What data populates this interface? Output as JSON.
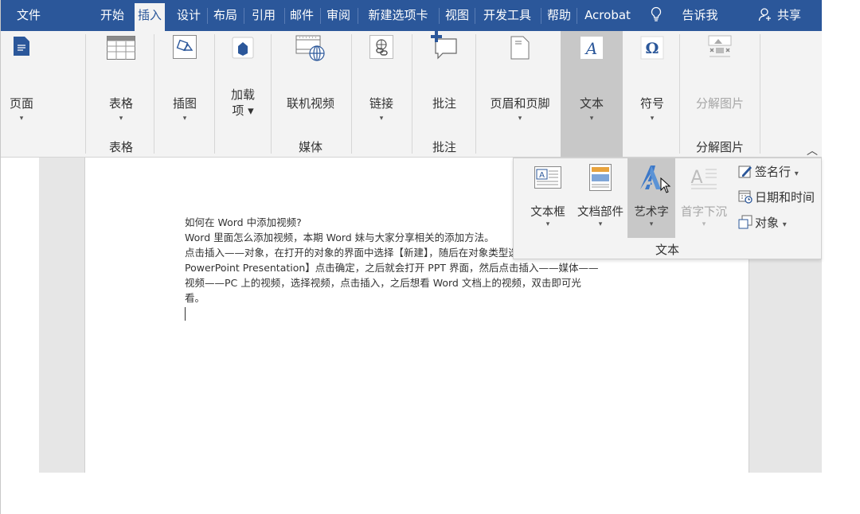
{
  "tabs": [
    "文件",
    "开始",
    "插入",
    "设计",
    "布局",
    "引用",
    "邮件",
    "审阅",
    "新建选项卡",
    "视图",
    "开发工具",
    "帮助",
    "Acrobat"
  ],
  "active_tab": "插入",
  "tell_me": "告诉我",
  "share": "共享",
  "ribbon": {
    "page": "页面",
    "table": "表格",
    "illustrations": "插图",
    "addins_line1": "加载",
    "addins_line2": "项",
    "online_video": "联机视频",
    "link": "链接",
    "comment": "批注",
    "header_footer": "页眉和页脚",
    "text": "文本",
    "symbol": "符号",
    "split_image": "分解图片"
  },
  "groups": {
    "table": "表格",
    "media": "媒体",
    "comments": "批注",
    "split_image": "分解图片"
  },
  "text_panel": {
    "textbox": "文本框",
    "quick_parts": "文档部件",
    "wordart": "艺术字",
    "dropcap": "首字下沉",
    "signature_line": "签名行",
    "date_time": "日期和时间",
    "object": "对象",
    "group_label": "文本"
  },
  "document": {
    "lines": [
      "如何在 Word 中添加视频?",
      "Word 里面怎么添加视频，本期 Word 妹与大家分享相关的添加方法。",
      "点击插入——对象，在打开的对象的界面中选择【新建】，随后在对象类型选择【Microsoft",
      "PowerPoint Presentation】点击确定，之后就会打开 PPT 界面，然后点击插入——媒体——",
      "视频——PC 上的视频，选择视频，点击插入，之后想看 Word 文档上的视频，双击即可光",
      "看。"
    ]
  },
  "colors": {
    "tabbar": "#2b579a",
    "ribbon": "#f3f3f3",
    "highlight": "#c8c8c8",
    "wordart_blue": "#3c78c8"
  },
  "icons": [
    "page-icon",
    "table-icon",
    "illustrations-icon",
    "addins-icon",
    "online-video-icon",
    "link-icon",
    "comment-icon",
    "header-footer-icon",
    "text-icon",
    "symbol-icon",
    "split-image-icon",
    "textbox-icon",
    "quick-parts-icon",
    "wordart-icon",
    "dropcap-icon",
    "signature-icon",
    "date-time-icon",
    "object-icon",
    "lightbulb-icon",
    "person-icon",
    "mouse-pointer-icon"
  ]
}
